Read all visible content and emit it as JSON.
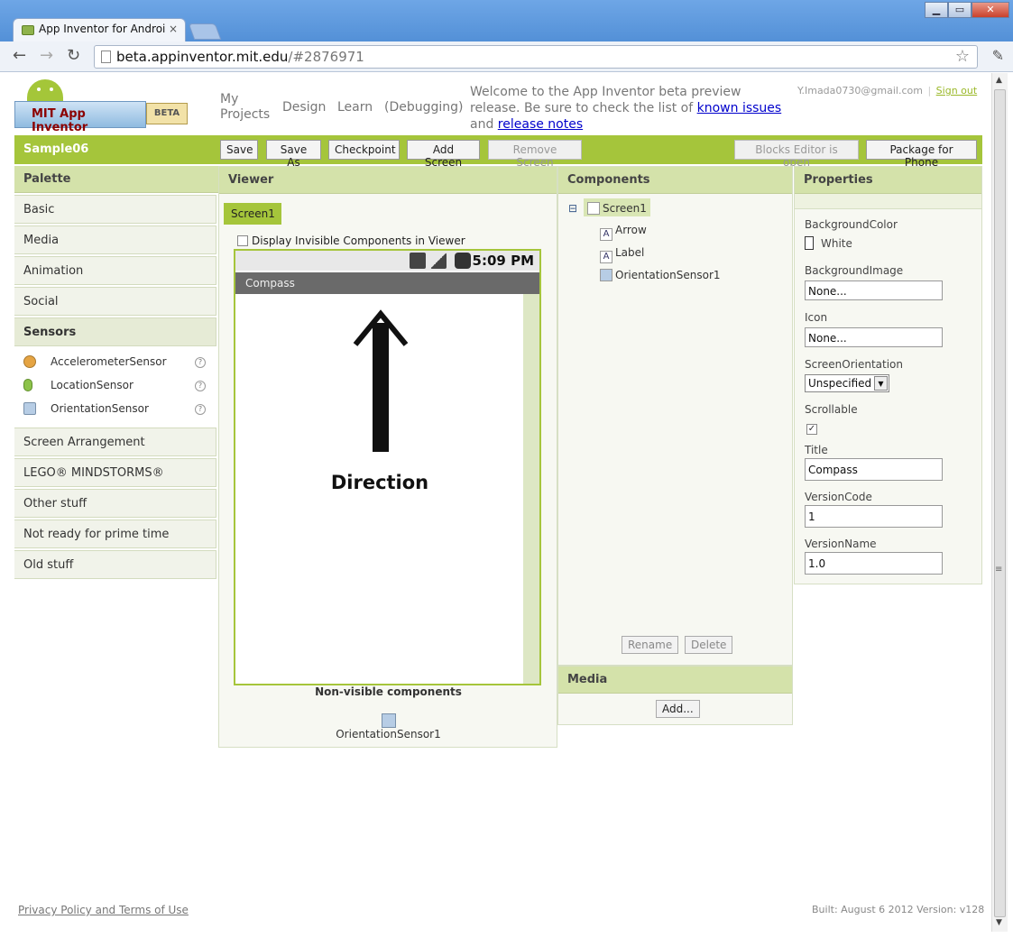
{
  "browser": {
    "tab_title": "App Inventor for Androi",
    "url_host": "beta.appinventor.mit.edu",
    "url_rest": "/#2876971"
  },
  "header": {
    "logo_text": "MIT App Inventor",
    "logo_badge": "BETA",
    "nav": [
      "My Projects",
      "Design",
      "Learn",
      "(Debugging)"
    ],
    "welcome_pre": "Welcome to the App Inventor beta preview release. Be sure to check the list of ",
    "link_issues": "known issues",
    "welcome_and": " and ",
    "link_notes": "release notes",
    "user_email": "Y.Imada0730@gmail.com",
    "separator": "|",
    "sign_out": "Sign out"
  },
  "project": {
    "name": "Sample06",
    "buttons": [
      "Save",
      "Save As",
      "Checkpoint",
      "Add Screen",
      "Remove Screen"
    ],
    "blocks_editor": "Blocks Editor is open",
    "package": "Package for Phone"
  },
  "palette": {
    "title": "Palette",
    "categories": [
      "Basic",
      "Media",
      "Animation",
      "Social",
      "Sensors"
    ],
    "sensors": [
      "AccelerometerSensor",
      "LocationSensor",
      "OrientationSensor"
    ],
    "help": "?",
    "more": [
      "Screen Arrangement",
      "LEGO® MINDSTORMS®",
      "Other stuff",
      "Not ready for prime time",
      "Old stuff"
    ]
  },
  "viewer": {
    "title": "Viewer",
    "screen_tab": "Screen1",
    "display_invisible": "Display Invisible Components in Viewer",
    "time": "5:09 PM",
    "app_title": "Compass",
    "direction_label": "Direction",
    "nonvisible_title": "Non-visible components",
    "nonvisible_item": "OrientationSensor1"
  },
  "components": {
    "title": "Components",
    "collapse": "⊟",
    "root": "Screen1",
    "children": [
      "Arrow",
      "Label",
      "OrientationSensor1"
    ],
    "rename": "Rename",
    "delete": "Delete"
  },
  "media": {
    "title": "Media",
    "add": "Add..."
  },
  "properties": {
    "title": "Properties",
    "bg_color_label": "BackgroundColor",
    "bg_color_value": "White",
    "bg_image_label": "BackgroundImage",
    "bg_image_value": "None...",
    "icon_label": "Icon",
    "icon_value": "None...",
    "orientation_label": "ScreenOrientation",
    "orientation_value": "Unspecified",
    "scrollable_label": "Scrollable",
    "scrollable_checked": "✓",
    "title_label": "Title",
    "title_value": "Compass",
    "version_code_label": "VersionCode",
    "version_code_value": "1",
    "version_name_label": "VersionName",
    "version_name_value": "1.0"
  },
  "footer": {
    "privacy": "Privacy Policy and Terms of Use",
    "built": "Built: August 6 2012 Version: v128"
  },
  "colors": {
    "accent_green": "#a5c53b",
    "panel_header": "#d4e2aa",
    "link_blue": "#0000cc"
  }
}
